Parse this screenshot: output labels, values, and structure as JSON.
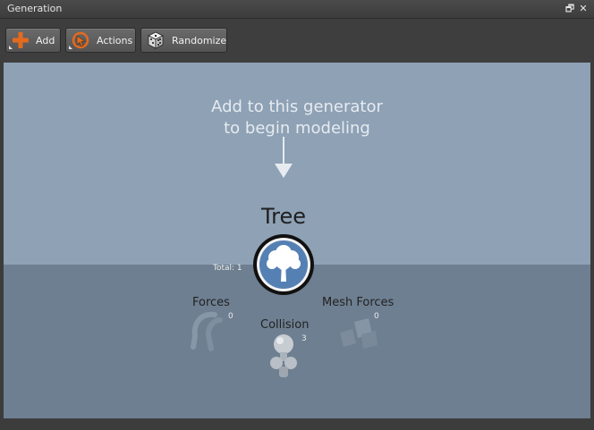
{
  "window": {
    "title": "Generation",
    "restore_glyph": "🗗",
    "close_glyph": "✕"
  },
  "toolbar": {
    "add": {
      "label": "Add",
      "icon": "plus-icon"
    },
    "actions": {
      "label": "Actions",
      "icon": "actions-icon"
    },
    "randomize": {
      "label": "Randomize",
      "icon": "dice-icon"
    }
  },
  "canvas": {
    "hint_line1": "Add to this generator",
    "hint_line2": "to begin modeling",
    "root": {
      "name": "Tree",
      "total_label": "Total: 1",
      "icon": "tree-icon"
    },
    "children": [
      {
        "name": "Forces",
        "count": "0",
        "icon": "magnet-icon"
      },
      {
        "name": "Collision",
        "count": "3",
        "icon": "collision-icon"
      },
      {
        "name": "Mesh Forces",
        "count": "0",
        "icon": "mesh-forces-icon"
      }
    ]
  },
  "colors": {
    "sky": "#8ea1b5",
    "ground": "#6e7f91",
    "node_fill": "#5580b4",
    "accent_orange": "#e46a1e"
  }
}
